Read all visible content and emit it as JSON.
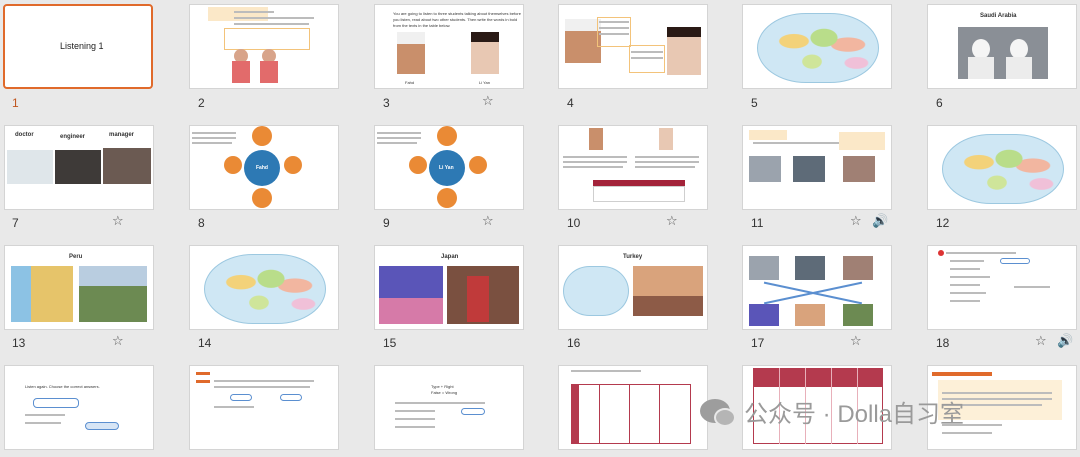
{
  "slides": [
    {
      "number": "1",
      "title": "Listening 1"
    },
    {
      "number": "2"
    },
    {
      "number": "3",
      "lines": [
        "You are going to listen to three students talking about themselves before",
        "you listen, read about two other students. Then write the words in bold",
        "from the texts in the table below."
      ],
      "captions": [
        "Fahd",
        "Li Yan"
      ]
    },
    {
      "number": "4"
    },
    {
      "number": "5"
    },
    {
      "number": "6",
      "title": "Saudi Arabia"
    },
    {
      "number": "7",
      "labels": [
        "doctor",
        "engineer",
        "manager"
      ]
    },
    {
      "number": "8",
      "center": "Fahd"
    },
    {
      "number": "9",
      "center": "Li Yan"
    },
    {
      "number": "10"
    },
    {
      "number": "11"
    },
    {
      "number": "12"
    },
    {
      "number": "13",
      "title": "Peru"
    },
    {
      "number": "14"
    },
    {
      "number": "15",
      "title": "Japan"
    },
    {
      "number": "16",
      "title": "Turkey"
    },
    {
      "number": "17"
    },
    {
      "number": "18"
    },
    {
      "number": "",
      "lines": [
        "Listen again. Choose the correct answers."
      ]
    },
    {
      "number": ""
    },
    {
      "number": "",
      "lines": [
        "Type + Right",
        "False = Wrong"
      ]
    },
    {
      "number": ""
    },
    {
      "number": ""
    },
    {
      "number": ""
    }
  ],
  "watermark": {
    "text": "公众号 · Dolla自习室"
  },
  "icons": {
    "star": "star-icon",
    "audio": "audio-icon"
  }
}
